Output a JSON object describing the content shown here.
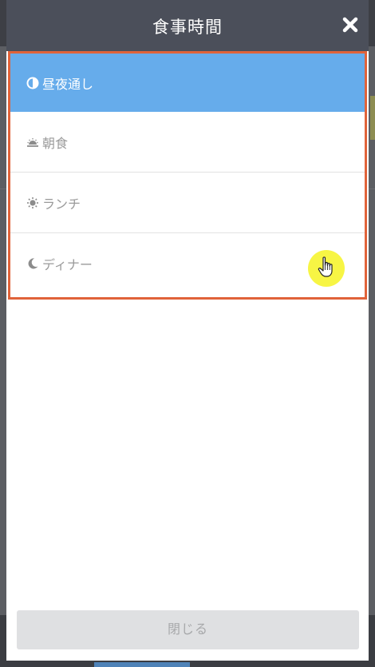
{
  "modal": {
    "title": "食事時間",
    "close_icon": "close-icon"
  },
  "meal_times": [
    {
      "label": "昼夜通し",
      "icon": "half-circle-icon",
      "selected": true
    },
    {
      "label": "朝食",
      "icon": "sunrise-icon",
      "selected": false
    },
    {
      "label": "ランチ",
      "icon": "sun-icon",
      "selected": false
    },
    {
      "label": "ディナー",
      "icon": "moon-icon",
      "selected": false
    }
  ],
  "footer": {
    "close_label": "閉じる"
  },
  "colors": {
    "header_bg": "#4b4f5a",
    "selected_bg": "#66aceb",
    "highlight_border": "#e0633a",
    "cursor_highlight": "#f7f544"
  }
}
